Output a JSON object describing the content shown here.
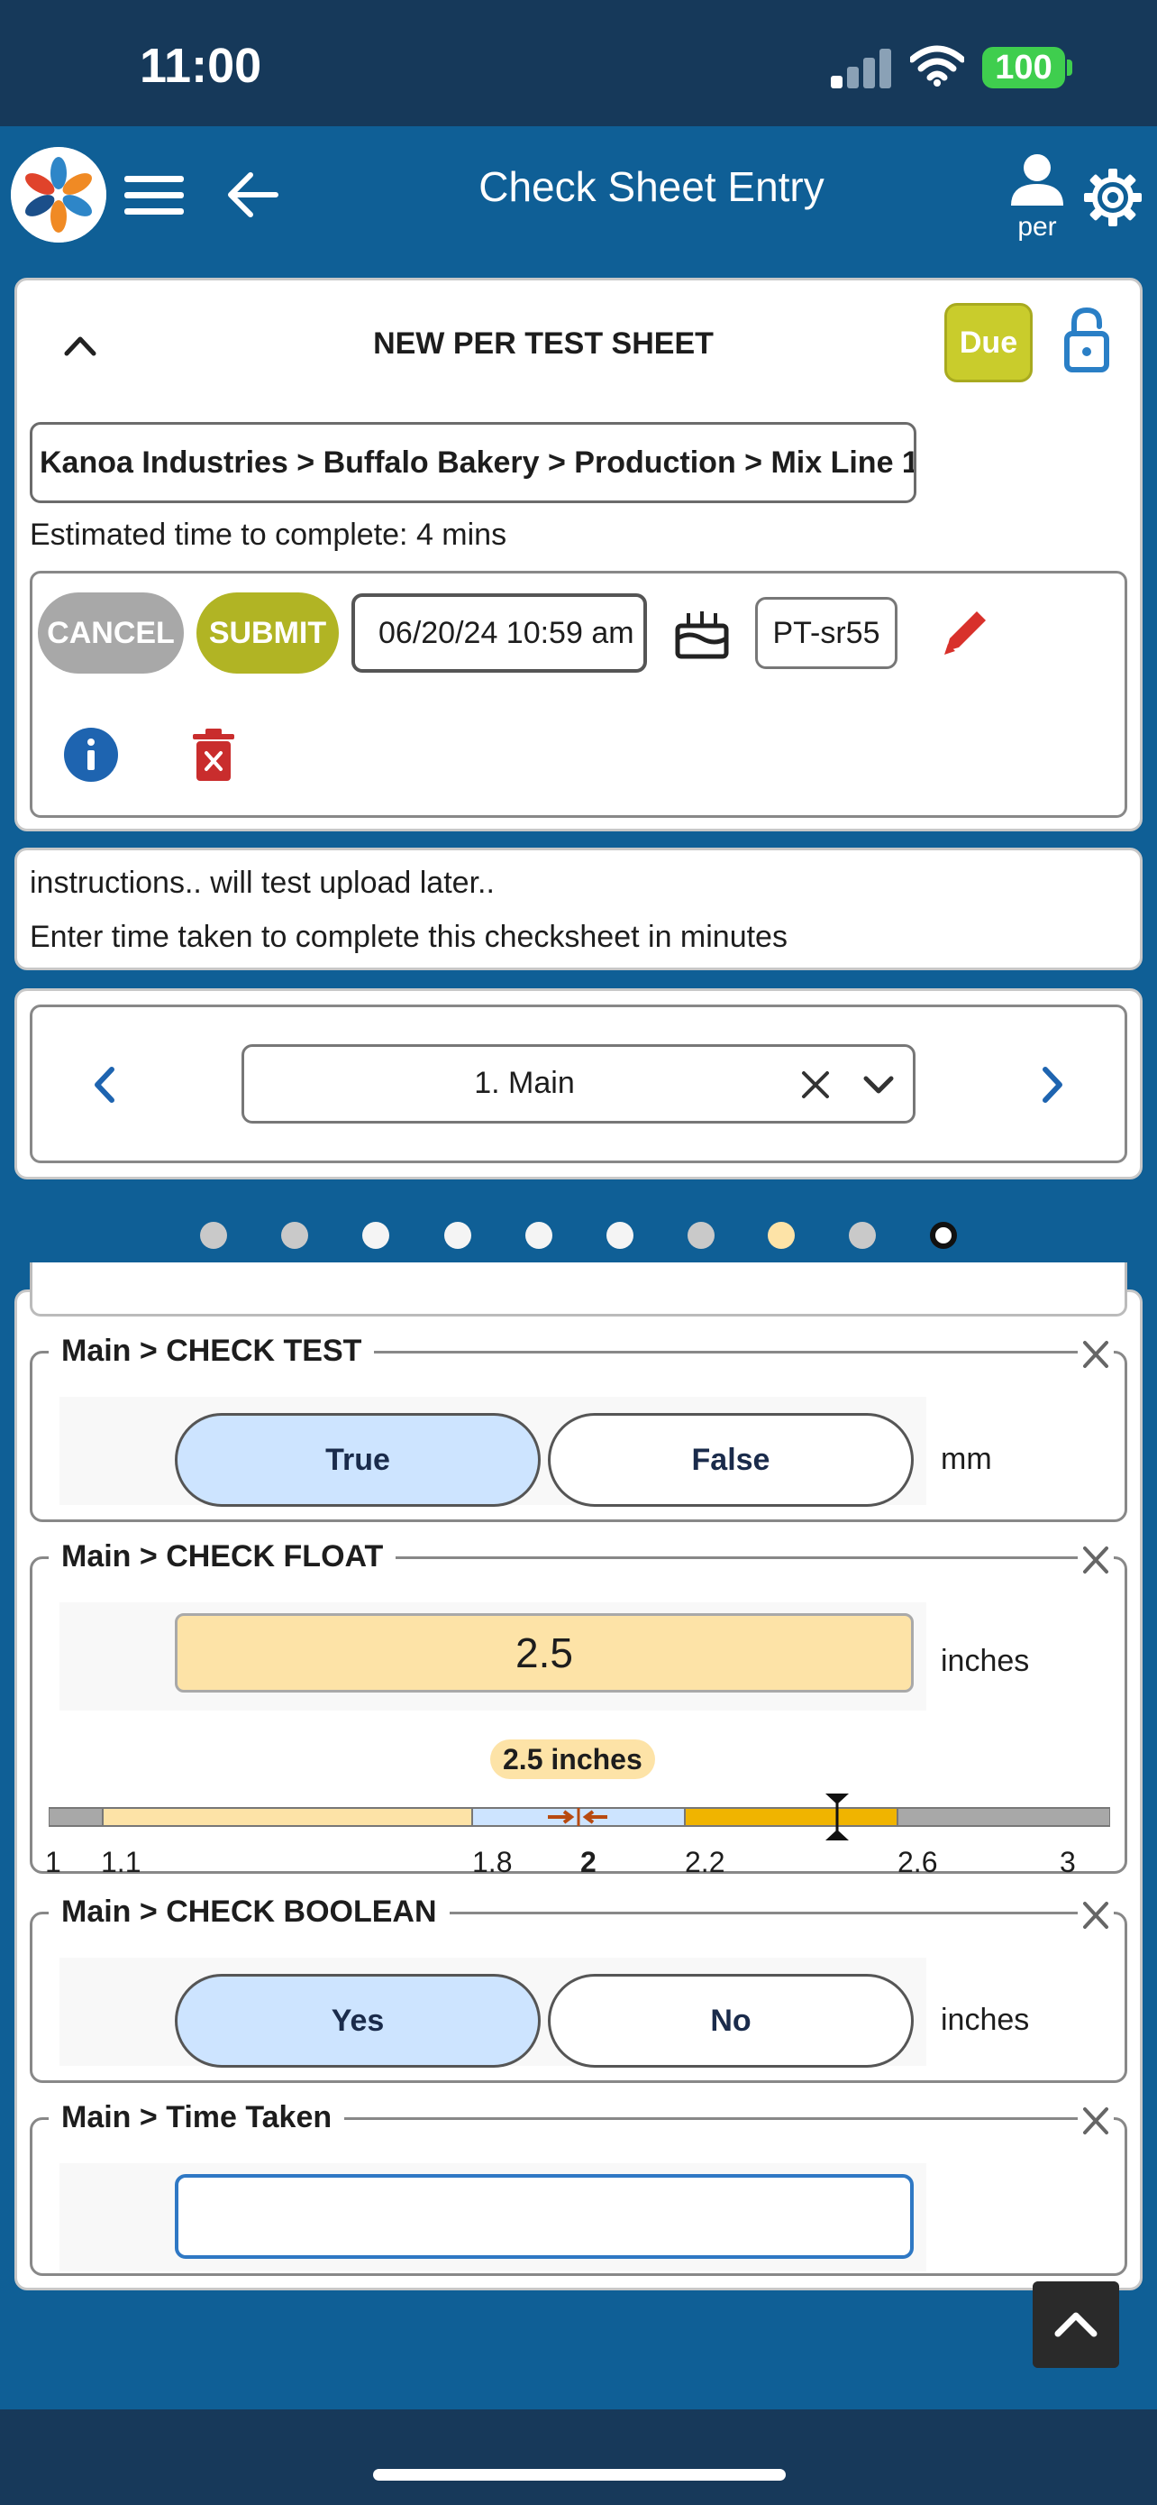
{
  "status_bar": {
    "time": "11:00",
    "battery": "100"
  },
  "header": {
    "title": "Check Sheet Entry",
    "user_label": "per"
  },
  "sheet": {
    "title": "NEW PER TEST SHEET",
    "due_label": "Due",
    "breadcrumb": "Kanoa Industries > Buffalo Bakery > Production > Mix Line 1",
    "estimated_time": "Estimated time to complete: 4 mins",
    "cancel_label": "CANCEL",
    "submit_label": "SUBMIT",
    "date_value": "06/20/24 10:59 am",
    "id_value": "PT-sr55"
  },
  "instructions": {
    "line1": "instructions.. will test upload later..",
    "line2": "Enter time taken to complete this checksheet in minutes"
  },
  "section_nav": {
    "selected": "1. Main",
    "dots": [
      {
        "color": "#c9c9c9"
      },
      {
        "color": "#c9c9c9"
      },
      {
        "color": "#f4f4f4"
      },
      {
        "color": "#f4f4f4"
      },
      {
        "color": "#f4f4f4"
      },
      {
        "color": "#f4f4f4"
      },
      {
        "color": "#c9c9c9"
      },
      {
        "color": "#fde3a7"
      },
      {
        "color": "#c9c9c9"
      },
      {
        "color": "#ffffff",
        "active": true
      }
    ]
  },
  "fields": {
    "check_test": {
      "title": "Main > CHECK TEST",
      "opt1": "True",
      "opt2": "False",
      "unit": "mm",
      "selected": "True"
    },
    "check_float": {
      "title": "Main > CHECK FLOAT",
      "value": "2.5",
      "unit": "inches",
      "gauge_label": "2.5 inches",
      "ticks": [
        "1",
        "1.1",
        "1.8",
        "2",
        "2.2",
        "2.6",
        "3"
      ]
    },
    "check_boolean": {
      "title": "Main > CHECK BOOLEAN",
      "opt1": "Yes",
      "opt2": "No",
      "unit": "inches",
      "selected": "Yes"
    },
    "time_taken": {
      "title": "Main > Time Taken",
      "value": ""
    }
  },
  "colors": {
    "header_bg": "#0f5f96",
    "status_bg": "#16395a",
    "due_badge": "#c9cc2c",
    "submit": "#b1b424",
    "cancel": "#a8a8a8",
    "selected_toggle": "#cde4ff",
    "float_fill": "#fde3a7"
  }
}
